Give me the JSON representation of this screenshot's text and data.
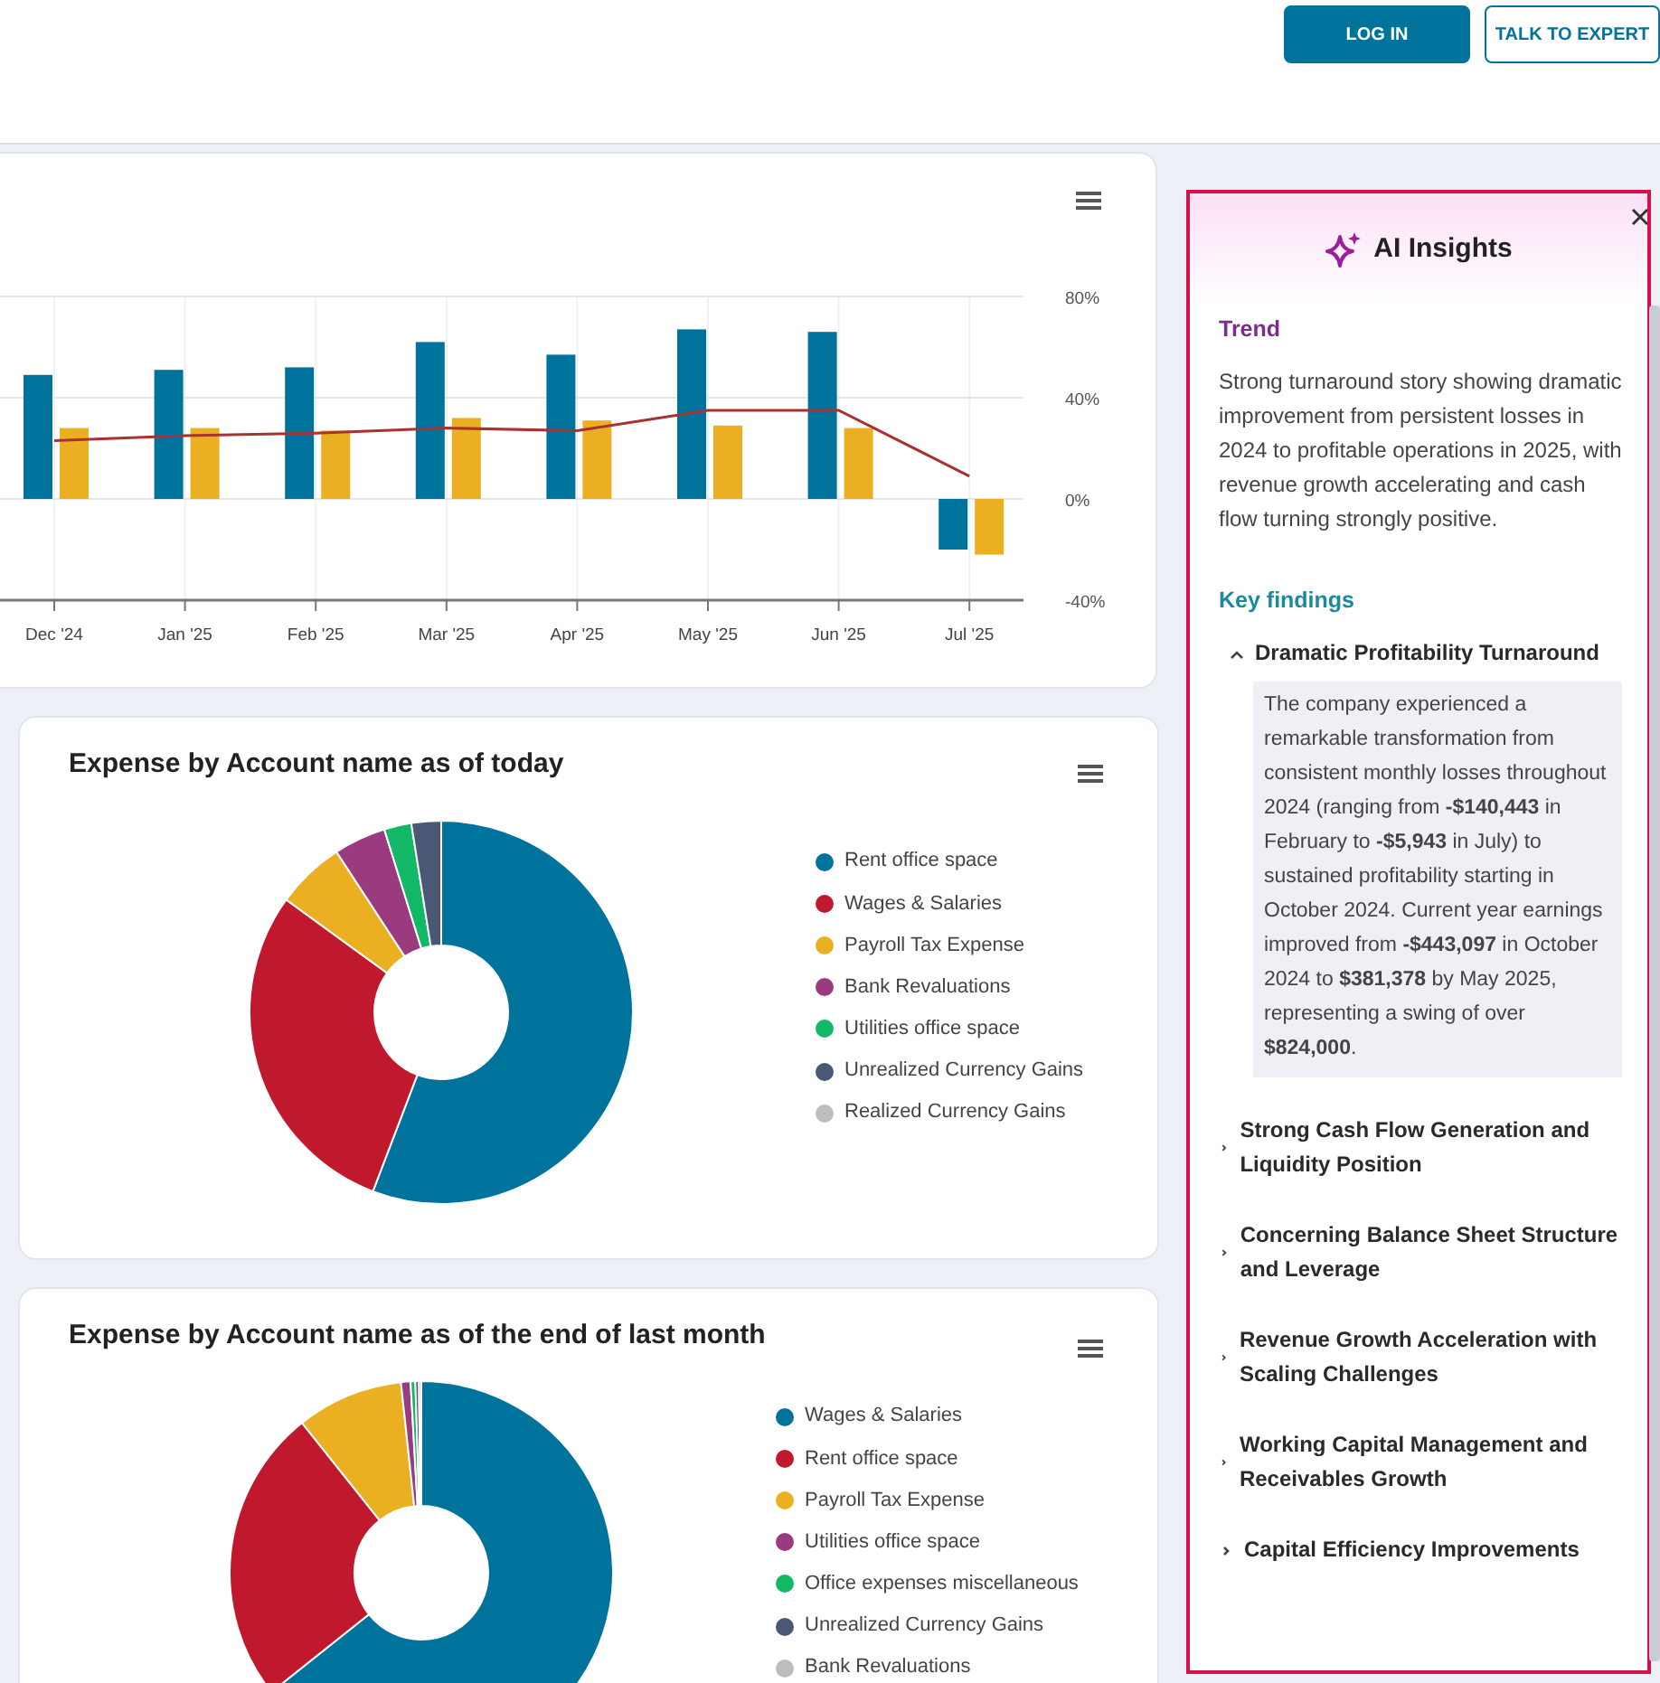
{
  "header": {
    "buttons": [
      {
        "label": "LOG IN",
        "kind": "primary"
      },
      {
        "label": "TALK TO EXPERT",
        "kind": "outline"
      }
    ]
  },
  "performance_chart": {
    "chart_data": {
      "type": "bar",
      "categories": [
        "Dec '24",
        "Jan '25",
        "Feb '25",
        "Mar '25",
        "Apr '25",
        "May '25",
        "Jun '25",
        "Jul '25"
      ],
      "series": [
        {
          "color": "#00739c",
          "values": [
            49,
            51,
            52,
            62,
            57,
            67,
            66,
            -20
          ]
        },
        {
          "color": "#ebb022",
          "values": [
            28,
            28,
            27,
            32,
            31,
            29,
            28,
            -22
          ]
        },
        {
          "type": "line",
          "color": "#a83232",
          "values": [
            23,
            25,
            26,
            28,
            27,
            35,
            35,
            9
          ]
        }
      ],
      "stacked": false,
      "grid": true,
      "ylim": [
        -40,
        80
      ],
      "yticks": [
        {
          "value": 80,
          "label": "80%"
        },
        {
          "value": 40,
          "label": "40%"
        },
        {
          "value": 0,
          "label": "0%"
        },
        {
          "value": -40,
          "label": "-40%"
        }
      ]
    }
  },
  "expense_charts": [
    {
      "title": "Expense by Account name as of today",
      "legend": [
        {
          "label": "Rent office space",
          "color": "#00739c"
        },
        {
          "label": "Wages & Salaries",
          "color": "#c0192e"
        },
        {
          "label": "Payroll Tax Expense",
          "color": "#ebb022"
        },
        {
          "label": "Bank Revaluations",
          "color": "#9b3b7f"
        },
        {
          "label": "Utilities office space",
          "color": "#12b866"
        },
        {
          "label": "Unrealized Currency Gains",
          "color": "#4a5775"
        },
        {
          "label": "Realized Currency Gains",
          "color": "#bdbdbd"
        }
      ]
    },
    {
      "title": "Expense by Account name as of the end of last month",
      "legend": [
        {
          "label": "Wages & Salaries",
          "color": "#00739c"
        },
        {
          "label": "Rent office space",
          "color": "#c0192e"
        },
        {
          "label": "Payroll Tax Expense",
          "color": "#ebb022"
        },
        {
          "label": "Utilities office space",
          "color": "#9b3b7f"
        },
        {
          "label": "Office expenses miscellaneous",
          "color": "#12b866"
        },
        {
          "label": "Unrealized Currency Gains",
          "color": "#4a5775"
        },
        {
          "label": "Bank Revaluations",
          "color": "#bdbdbd"
        }
      ]
    }
  ],
  "insights": {
    "title": "AI Insights",
    "trend": {
      "heading": "Trend",
      "text": "Strong turnaround story showing dramatic improvement from persistent losses in 2024 to profitable operations in 2025, with revenue growth accelerating and cash flow turning strongly positive."
    },
    "key_findings": {
      "heading": "Key findings",
      "items": [
        {
          "title": "Dramatic Profitability Turnaround",
          "expanded": true,
          "text": "The company experienced a remarkable transformation from consistent monthly losses throughout 2024 (ranging from **-$140,443** in February to **-$5,943** in July) to sustained profitability starting in October 2024. Current year earnings improved from **-$443,097** in October 2024 to **$381,378** by May 2025, representing a swing of over **$824,000**."
        },
        {
          "title": "Strong Cash Flow Generation and Liquidity Position",
          "expanded": false
        },
        {
          "title": "Concerning Balance Sheet Structure and Leverage",
          "expanded": false
        },
        {
          "title": "Revenue Growth Acceleration with Scaling Challenges",
          "expanded": false
        },
        {
          "title": "Working Capital Management and Receivables Growth",
          "expanded": false
        },
        {
          "title": "Capital Efficiency Improvements",
          "expanded": false
        }
      ]
    }
  }
}
